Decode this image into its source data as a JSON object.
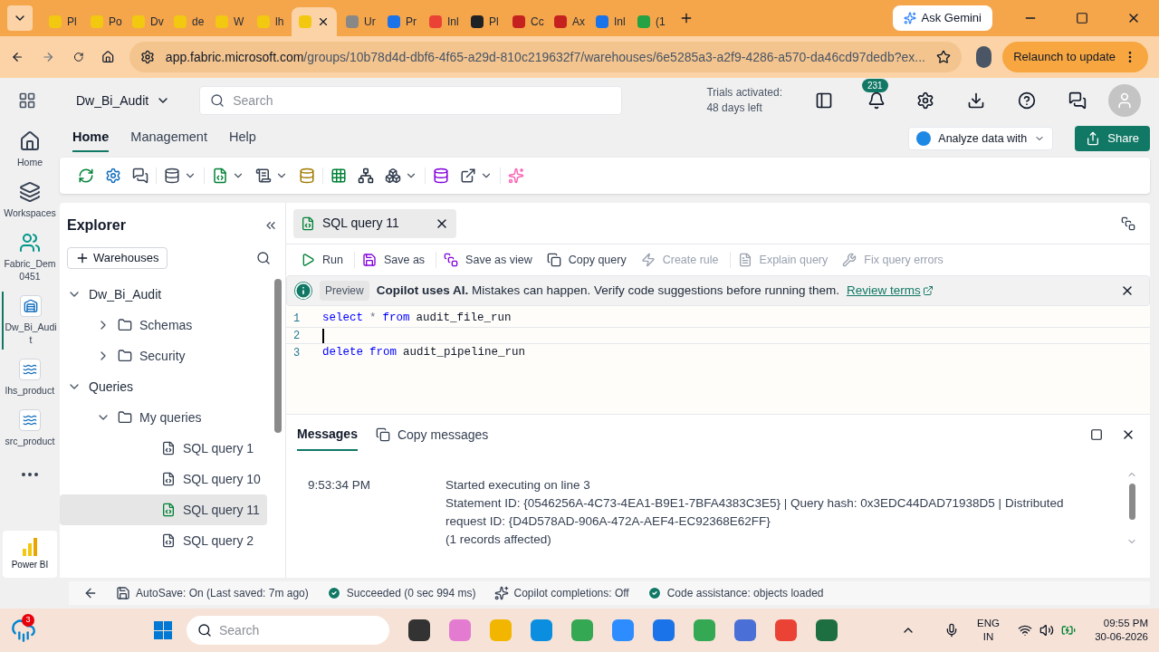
{
  "browser": {
    "tabs": [
      {
        "label": "Pl",
        "color": "#f2c811",
        "selected": false
      },
      {
        "label": "Po",
        "color": "#f2c811",
        "selected": false
      },
      {
        "label": "Dv",
        "color": "#f2c811",
        "selected": false
      },
      {
        "label": "de",
        "color": "#f2c811",
        "selected": false
      },
      {
        "label": "W",
        "color": "#f2c811",
        "selected": false
      },
      {
        "label": "lh",
        "color": "#f2c811",
        "selected": false
      },
      {
        "color": "#f2c811",
        "selected": true
      },
      {
        "label": "Ur",
        "color": "#8a8886",
        "selected": false
      },
      {
        "label": "Pr",
        "color": "#1a73e8",
        "selected": false
      },
      {
        "label": "Inl",
        "color": "#ea4335",
        "selected": false
      },
      {
        "label": "Pl",
        "color": "#202124",
        "selected": false
      },
      {
        "label": "Cc",
        "color": "#c5221f",
        "selected": false
      },
      {
        "label": "Ax",
        "color": "#c5221f",
        "selected": false
      },
      {
        "label": "Inl",
        "color": "#1a73e8",
        "selected": false
      },
      {
        "label": "(1",
        "color": "#25a244",
        "selected": false
      }
    ],
    "ask": "Ask Gemini",
    "url_host": "app.fabric.microsoft.com",
    "url_path": "/groups/10b78d4d-dbf6-4f65-a29d-810c219632f7/warehouses/6e5285a3-a2f9-4286-a570-da46cd97dedb?ex...",
    "relaunch": "Relaunch to update"
  },
  "header": {
    "workspace": "Dw_Bi_Audit",
    "search": {
      "placeholder": "Search"
    },
    "trial": [
      "Trials activated:",
      "48 days left"
    ],
    "notifications": "231"
  },
  "menu": [
    {
      "label": "Home",
      "selected": true
    },
    {
      "label": "Management",
      "selected": false
    },
    {
      "label": "Help",
      "selected": false
    }
  ],
  "analyze": "Analyze data with",
  "share": "Share",
  "ribbon": [
    {
      "tools": [
        {
          "menu": false
        },
        {
          "menu": false
        },
        {
          "menu": false
        }
      ]
    },
    {
      "tools": [
        {
          "menu": true
        }
      ]
    },
    {
      "tools": [
        {
          "menu": true
        },
        {
          "menu": true
        },
        {
          "menu": false
        }
      ]
    },
    {
      "tools": [
        {
          "menu": false
        },
        {
          "menu": false
        },
        {
          "menu": true
        }
      ]
    },
    {
      "tools": [
        {
          "menu": false
        },
        {
          "menu": true
        }
      ]
    },
    {
      "tools": [
        {
          "menu": false
        }
      ]
    }
  ],
  "rail": [
    {
      "label": "Home",
      "kind": "home",
      "selected": false
    },
    {
      "label": "Workspaces",
      "kind": "workspaces",
      "selected": false
    },
    {
      "label": "Fabric_Dem0451",
      "kind": "workspace",
      "selected": false
    },
    {
      "label": "Dw_Bi_Audit",
      "kind": "warehouse",
      "selected": true
    },
    {
      "label": "lhs_product",
      "kind": "lakehouse",
      "selected": false
    },
    {
      "label": "src_product",
      "kind": "lakehouse",
      "selected": false
    }
  ],
  "power_bi": "Power BI",
  "explorer": {
    "title": "Explorer",
    "add": "Warehouses",
    "tree": [
      {
        "label": "Dw_Bi_Audit",
        "kind": "section",
        "expanded": true,
        "selected": false,
        "children": [
          {
            "label": "Schemas",
            "kind": "folder",
            "expanded": false,
            "selected": false
          },
          {
            "label": "Security",
            "kind": "folder",
            "expanded": false,
            "selected": false
          }
        ]
      },
      {
        "label": "Queries",
        "kind": "section",
        "expanded": true,
        "selected": false,
        "children": [
          {
            "label": "My queries",
            "kind": "folder",
            "expanded": true,
            "selected": false,
            "children": [
              {
                "label": "SQL query 1",
                "kind": "query",
                "selected": false
              },
              {
                "label": "SQL query 10",
                "kind": "query",
                "selected": false
              },
              {
                "label": "SQL query 11",
                "kind": "query",
                "selected": true
              },
              {
                "label": "SQL query 2",
                "kind": "query",
                "selected": false
              }
            ]
          }
        ]
      }
    ]
  },
  "editor": {
    "tab": "SQL query 11",
    "actions": [
      {
        "label": "Run",
        "kind": "run",
        "disabled": false
      },
      {
        "label": "Save as",
        "kind": "save",
        "disabled": false
      },
      {
        "label": "Save as view",
        "kind": "view",
        "disabled": false
      },
      {
        "label": "Copy query",
        "kind": "copy",
        "disabled": false
      },
      {
        "label": "Create rule",
        "kind": "rule",
        "disabled": true
      },
      {
        "label": "Explain query",
        "kind": "explain",
        "disabled": true
      },
      {
        "label": "Fix query errors",
        "kind": "fix",
        "disabled": true
      }
    ],
    "banner": {
      "badge": "Preview",
      "text": "**Copilot uses AI.** Mistakes can happen. Verify code suggestions before running them.",
      "link": "Review terms"
    },
    "lines": [
      {
        "number": "1",
        "current": false,
        "tokens": [
          {
            "text": "select",
            "kind": "keyword"
          },
          {
            "text": "*",
            "kind": "operator"
          },
          {
            "text": "from",
            "kind": "keyword"
          },
          {
            "text": "audit_file_run",
            "kind": "name"
          }
        ]
      },
      {
        "number": "2",
        "current": true
      },
      {
        "number": "3",
        "current": false,
        "tokens": [
          {
            "text": "delete",
            "kind": "keyword"
          },
          {
            "text": "from",
            "kind": "keyword"
          },
          {
            "text": "audit_pipeline_run",
            "kind": "name"
          }
        ]
      }
    ]
  },
  "messages": {
    "tab": "Messages",
    "copy": "Copy messages",
    "time": "9:53:34 PM",
    "lines": [
      "Started executing on line 3",
      "Statement ID: {0546256A-4C73-4EA1-B9E1-7BFA4383C3E5} | Query hash: 0x3EDC44DAD71938D5 | Distributed request ID: {D4D578AD-906A-472A-AEF4-EC92368E62FF}",
      "(1 records affected)"
    ]
  },
  "status": [
    {
      "label": "AutoSave: On (Last saved: 7m ago)",
      "kind": "save"
    },
    {
      "label": "Succeeded (0 sec 994 ms)",
      "kind": "ok"
    },
    {
      "label": "Copilot completions: Off",
      "kind": "copilot"
    },
    {
      "label": "Code assistance: objects loaded",
      "kind": "ok"
    }
  ],
  "taskbar": {
    "weather_badge": "3",
    "search": {
      "placeholder": "Search"
    },
    "lang": [
      "ENG",
      "IN"
    ],
    "time": "09:55 PM",
    "date": "30-06-2026"
  }
}
